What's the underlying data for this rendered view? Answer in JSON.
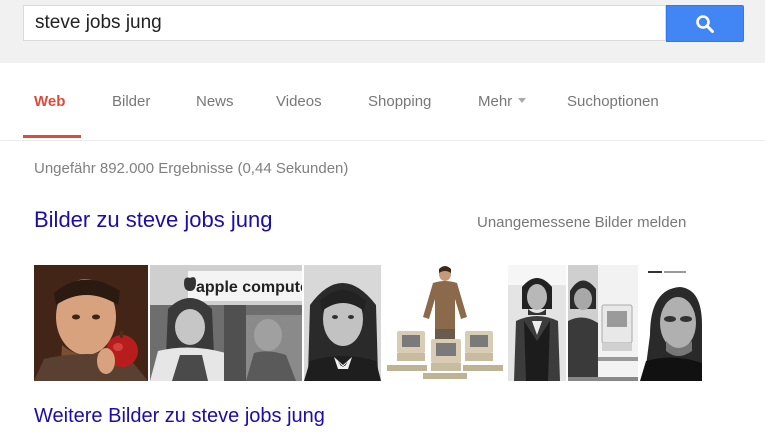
{
  "search": {
    "query": "steve jobs jung",
    "button_icon": "search-icon"
  },
  "tabs": [
    {
      "label": "Web",
      "active": true
    },
    {
      "label": "Bilder"
    },
    {
      "label": "News"
    },
    {
      "label": "Videos"
    },
    {
      "label": "Shopping"
    },
    {
      "label": "Mehr",
      "has_dropdown": true
    },
    {
      "label": "Suchoptionen"
    }
  ],
  "result_stats": "Ungefähr 892.000 Ergebnisse (0,44 Sekunden)",
  "images_section": {
    "heading": "Bilder zu steve jobs jung",
    "report_link": "Unangemessene Bilder melden",
    "more_link": "Weitere Bilder zu steve jobs jung",
    "sign_text": "apple computer"
  },
  "colors": {
    "accent_red": "#dd4b39",
    "link_blue": "#1a0dab",
    "search_blue": "#4285f4",
    "topbar_bg": "#f1f1f1"
  }
}
